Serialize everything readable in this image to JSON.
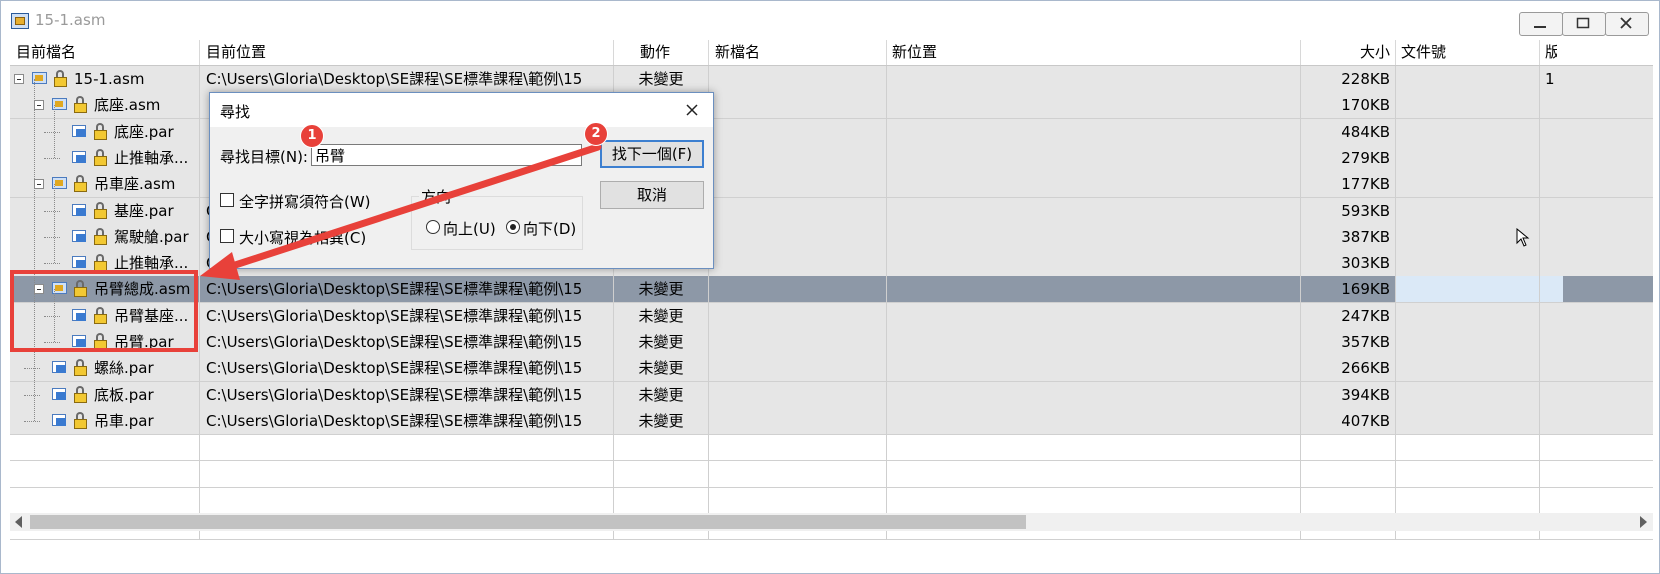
{
  "window": {
    "title": "15-1.asm"
  },
  "columns": [
    "目前檔名",
    "目前位置",
    "動作",
    "新檔名",
    "新位置",
    "大小",
    "文件號",
    "版"
  ],
  "rows": [
    {
      "name": "15-1.asm",
      "loc": "C:\\Users\\Gloria\\Desktop\\SE課程\\SE標準課程\\範例\\15",
      "action": "未變更",
      "size": "228KB",
      "ver": "1"
    },
    {
      "name": "底座.asm",
      "loc": "",
      "action": "",
      "size": "170KB",
      "ver": ""
    },
    {
      "name": "底座.par",
      "loc": "",
      "action": "",
      "size": "484KB",
      "ver": ""
    },
    {
      "name": "止推軸承...",
      "loc": "",
      "action": "",
      "size": "279KB",
      "ver": ""
    },
    {
      "name": "吊車座.asm",
      "loc": "",
      "action": "",
      "size": "177KB",
      "ver": ""
    },
    {
      "name": "基座.par",
      "loc": "C",
      "action": "",
      "size": "593KB",
      "ver": ""
    },
    {
      "name": "駕駛艙.par",
      "loc": "C",
      "action": "",
      "size": "387KB",
      "ver": ""
    },
    {
      "name": "止推軸承...",
      "loc": "C",
      "action": "",
      "size": "303KB",
      "ver": ""
    },
    {
      "name": "吊臂總成.asm",
      "loc": "C:\\Users\\Gloria\\Desktop\\SE課程\\SE標準課程\\範例\\15",
      "action": "未變更",
      "size": "169KB",
      "ver": ""
    },
    {
      "name": "吊臂基座...",
      "loc": "C:\\Users\\Gloria\\Desktop\\SE課程\\SE標準課程\\範例\\15",
      "action": "未變更",
      "size": "247KB",
      "ver": ""
    },
    {
      "name": "吊臂.par",
      "loc": "C:\\Users\\Gloria\\Desktop\\SE課程\\SE標準課程\\範例\\15",
      "action": "未變更",
      "size": "357KB",
      "ver": ""
    },
    {
      "name": "螺絲.par",
      "loc": "C:\\Users\\Gloria\\Desktop\\SE課程\\SE標準課程\\範例\\15",
      "action": "未變更",
      "size": "266KB",
      "ver": ""
    },
    {
      "name": "底板.par",
      "loc": "C:\\Users\\Gloria\\Desktop\\SE課程\\SE標準課程\\範例\\15",
      "action": "未變更",
      "size": "394KB",
      "ver": ""
    },
    {
      "name": "吊車.par",
      "loc": "C:\\Users\\Gloria\\Desktop\\SE課程\\SE標準課程\\範例\\15",
      "action": "未變更",
      "size": "407KB",
      "ver": ""
    }
  ],
  "dialog": {
    "title": "尋找",
    "find_label": "尋找目標(N):",
    "find_value": "吊臂",
    "whole_word_label": "全字拼寫須符合(W)",
    "match_case_label": "大小寫視為相異(C)",
    "direction_label": "方向",
    "up_label": "向上(U)",
    "down_label": "向下(D)",
    "find_next_label": "找下一個(F)",
    "cancel_label": "取消"
  },
  "annotations": {
    "badge1": "1",
    "badge2": "2"
  },
  "colors": {
    "annotation_red": "#e8413a",
    "selected_row": "#8d98a7",
    "data_row": "#e6e6e6"
  }
}
